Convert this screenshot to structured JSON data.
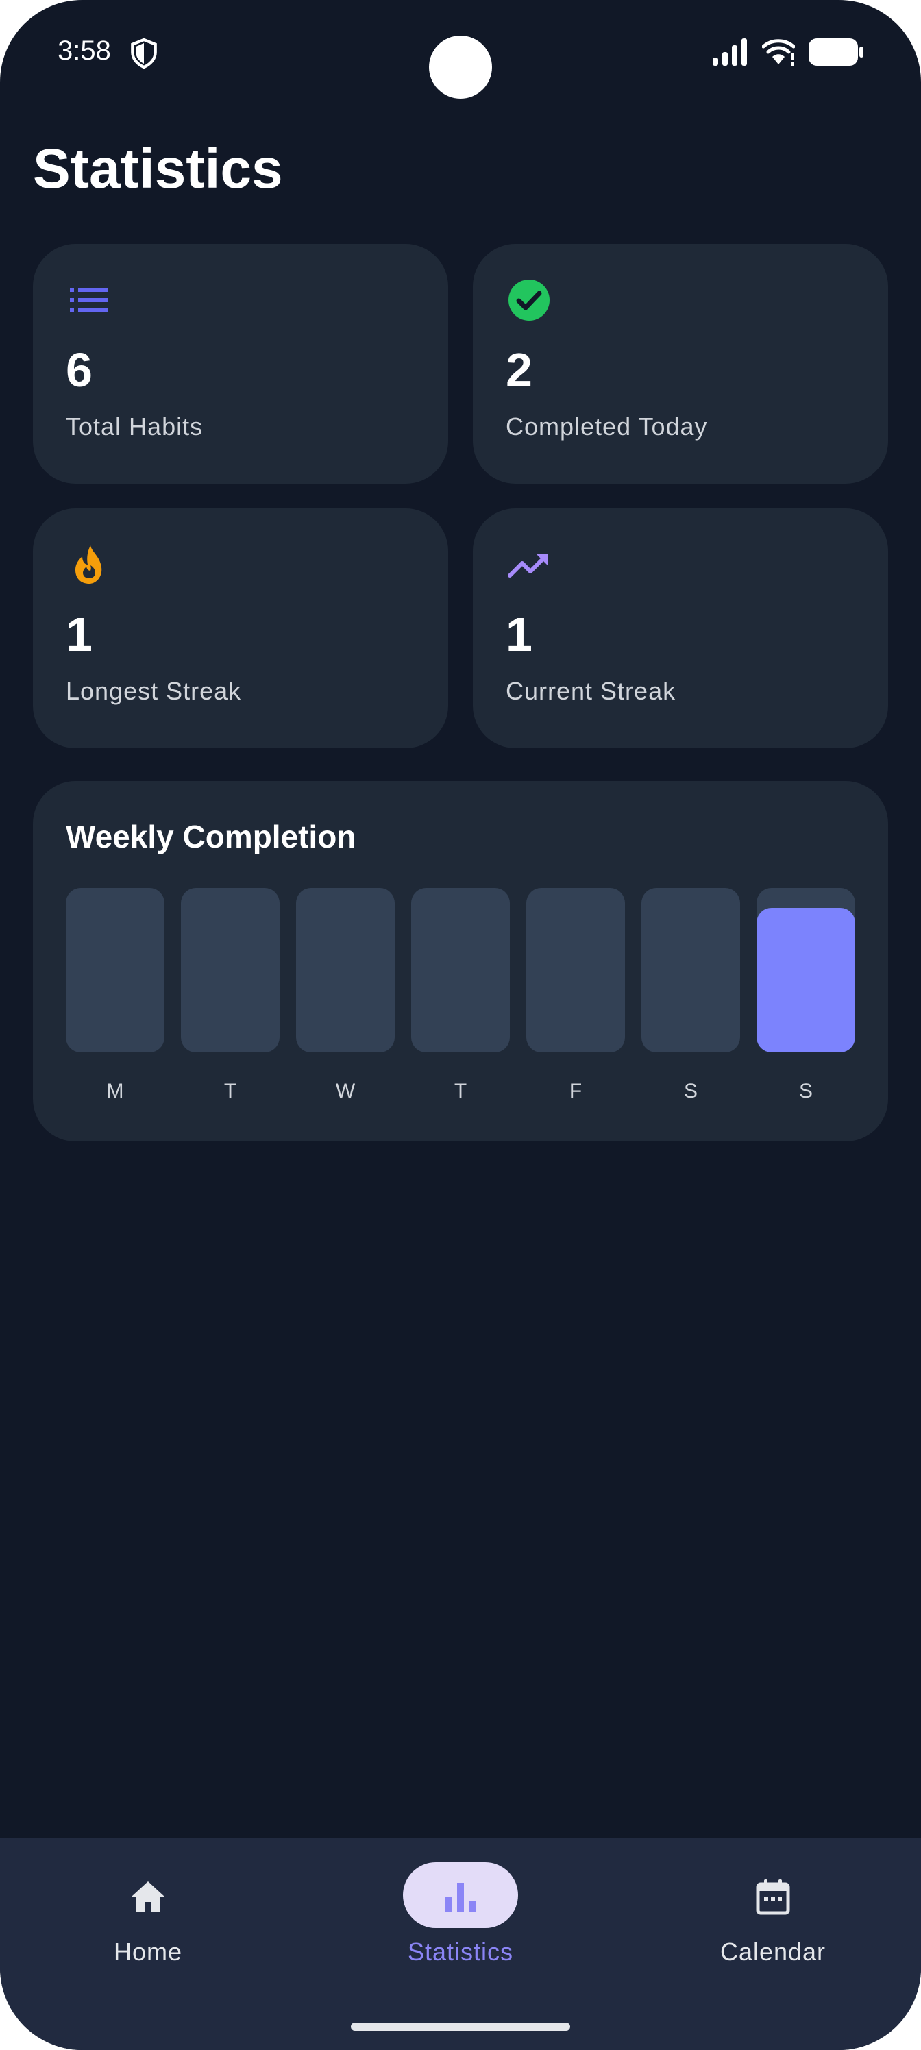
{
  "status_bar": {
    "time": "3:58"
  },
  "page": {
    "title": "Statistics"
  },
  "stats": [
    {
      "value": "6",
      "label": "Total Habits",
      "icon": "list-icon",
      "color": "#6366f1"
    },
    {
      "value": "2",
      "label": "Completed Today",
      "icon": "check-circle-icon",
      "color": "#22c55e"
    },
    {
      "value": "1",
      "label": "Longest Streak",
      "icon": "fire-icon",
      "color": "#f59e0b"
    },
    {
      "value": "1",
      "label": "Current Streak",
      "icon": "trending-up-icon",
      "color": "#a78bfa"
    }
  ],
  "weekly": {
    "title": "Weekly Completion",
    "chart_data": {
      "type": "bar",
      "categories": [
        "M",
        "T",
        "W",
        "T",
        "F",
        "S",
        "S"
      ],
      "values": [
        0,
        0,
        0,
        0,
        0,
        0,
        0.88
      ],
      "ylim": [
        0,
        1
      ]
    },
    "bar_color": "#7c83fd",
    "track_color": "#334155"
  },
  "nav": {
    "items": [
      {
        "label": "Home",
        "icon": "home-icon",
        "active": false
      },
      {
        "label": "Statistics",
        "icon": "bar-chart-icon",
        "active": true
      },
      {
        "label": "Calendar",
        "icon": "calendar-icon",
        "active": false
      }
    ]
  }
}
